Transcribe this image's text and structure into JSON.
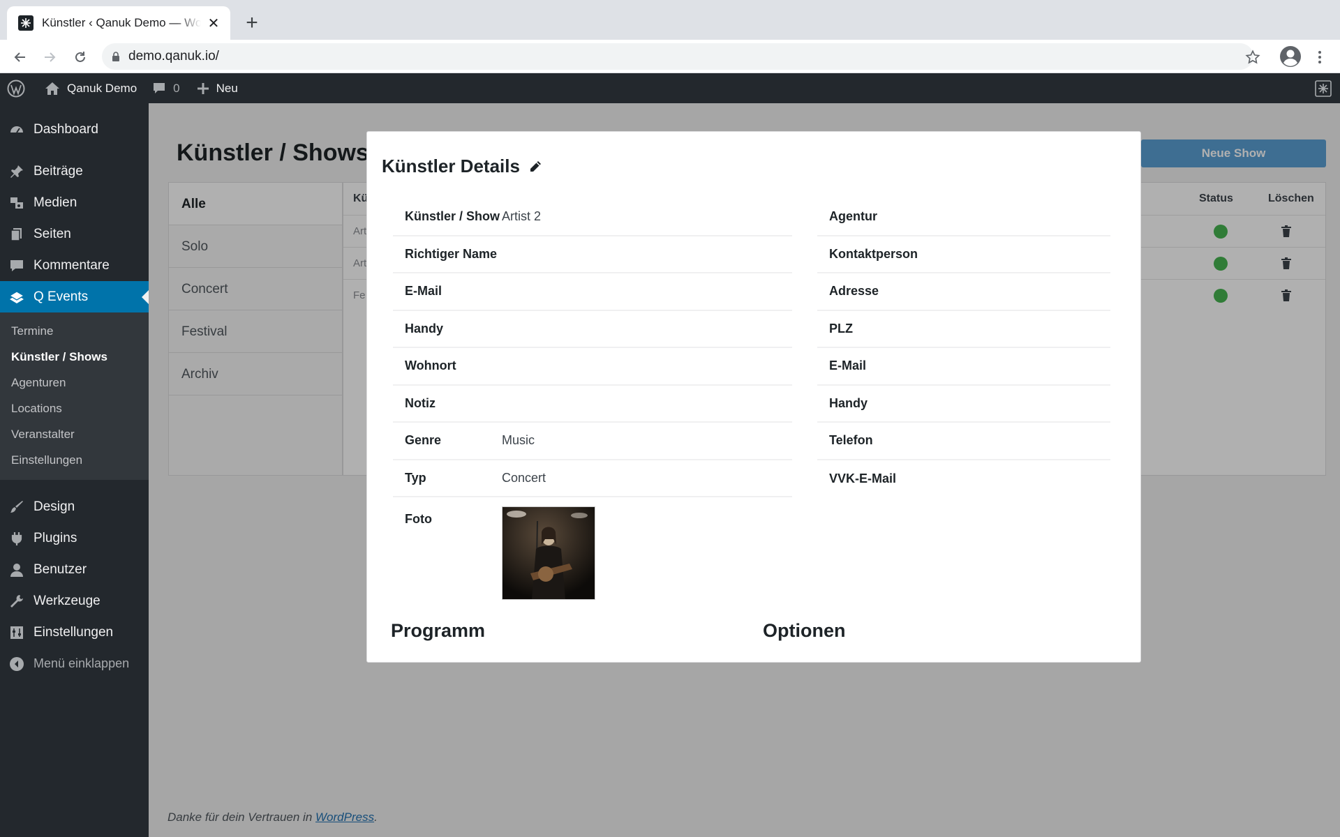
{
  "browser": {
    "tab_title": "Künstler ‹ Qanuk Demo — WordPress",
    "new_tab": "+",
    "close": "✕",
    "url": "demo.qanuk.io/"
  },
  "adminbar": {
    "site_name": "Qanuk Demo",
    "comments_count": "0",
    "new_label": "Neu"
  },
  "sidebar": {
    "items_top": [
      {
        "label": "Dashboard",
        "icon": "dashboard-icon"
      }
    ],
    "items_main": [
      {
        "label": "Beiträge",
        "icon": "pin-icon"
      },
      {
        "label": "Medien",
        "icon": "media-icon"
      },
      {
        "label": "Seiten",
        "icon": "pages-icon"
      },
      {
        "label": "Kommentare",
        "icon": "comment-icon"
      }
    ],
    "active_item": {
      "label": "Q Events",
      "icon": "events-icon"
    },
    "submenu": [
      "Termine",
      "Künstler / Shows",
      "Agenturen",
      "Locations",
      "Veranstalter",
      "Einstellungen"
    ],
    "items_bottom": [
      {
        "label": "Design",
        "icon": "brush-icon"
      },
      {
        "label": "Plugins",
        "icon": "plugin-icon"
      },
      {
        "label": "Benutzer",
        "icon": "user-icon"
      },
      {
        "label": "Werkzeuge",
        "icon": "wrench-icon"
      },
      {
        "label": "Einstellungen",
        "icon": "settings-icon"
      }
    ],
    "collapse_label": "Menü einklappen"
  },
  "page": {
    "title": "Künstler / Shows",
    "new_button": "Neue Show",
    "filters": [
      "Alle",
      "Solo",
      "Concert",
      "Festival",
      "Archiv"
    ],
    "table": {
      "col_name": "Kü",
      "col_status": "Status",
      "col_delete": "Löschen",
      "rows": [
        "Art",
        "Art",
        "Fe"
      ]
    },
    "footer_text": "Danke für dein Vertrauen in ",
    "footer_link": "WordPress",
    "footer_end": "."
  },
  "modal": {
    "title": "Künstler Details",
    "left_fields": [
      {
        "label": "Künstler / Show",
        "value": "Artist 2"
      },
      {
        "label": "Richtiger Name",
        "value": ""
      },
      {
        "label": "E-Mail",
        "value": ""
      },
      {
        "label": "Handy",
        "value": ""
      },
      {
        "label": "Wohnort",
        "value": ""
      },
      {
        "label": "Notiz",
        "value": ""
      },
      {
        "label": "Genre",
        "value": "Music"
      },
      {
        "label": "Typ",
        "value": "Concert"
      }
    ],
    "photo_label": "Foto",
    "right_fields": [
      {
        "label": "Agentur",
        "value": ""
      },
      {
        "label": "Kontaktperson",
        "value": ""
      },
      {
        "label": "Adresse",
        "value": ""
      },
      {
        "label": "PLZ",
        "value": ""
      },
      {
        "label": "E-Mail",
        "value": ""
      },
      {
        "label": "Handy",
        "value": ""
      },
      {
        "label": "Telefon",
        "value": ""
      },
      {
        "label": "VVK-E-Mail",
        "value": ""
      }
    ],
    "section_program": "Programm",
    "section_options": "Optionen"
  },
  "colors": {
    "admin_dark": "#23282d",
    "accent": "#0073aa",
    "status_active": "#46b450"
  }
}
